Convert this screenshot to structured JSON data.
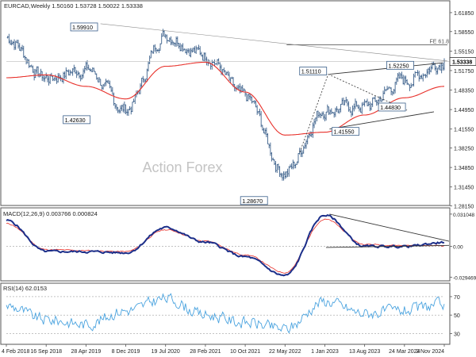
{
  "chart_data": [
    {
      "type": "line",
      "panel": "price",
      "header": "EURCAD,Weekly  1.50160 1.53728 1.50022 1.53338",
      "ylim": [
        1.285,
        1.635
      ],
      "y_ticks": [
        "1.61850",
        "1.58550",
        "1.55150",
        "1.51750",
        "1.48350",
        "1.44950",
        "1.41550",
        "1.38250",
        "1.34850",
        "1.31450",
        "1.28150"
      ],
      "last_price": "1.53338",
      "x_ticks": [
        "4 Feb 2018",
        "16 Sep 2018",
        "28 Apr 2019",
        "8 Dec 2019",
        "19 Jul 2020",
        "28 Feb 2021",
        "10 Oct 2021",
        "22 May 2022",
        "1 Jan 2023",
        "13 Aug 2023",
        "24 Mar 2024",
        "3 Nov 2024"
      ],
      "x": [
        "4 Feb 2018",
        "16 Sep 2018",
        "28 Apr 2019",
        "8 Dec 2019",
        "19 Jul 2020",
        "28 Feb 2021",
        "10 Oct 2021",
        "22 May 2022",
        "1 Jan 2023",
        "13 Aug 2023",
        "24 Mar 2024",
        "3 Nov 2024"
      ],
      "series": [
        {
          "values": [
            1.575,
            1.505,
            1.52,
            1.45,
            1.58,
            1.545,
            1.47,
            1.34,
            1.45,
            1.455,
            1.5,
            1.533
          ]
        },
        {
          "values": [
            1.505,
            1.51,
            1.49,
            1.468,
            1.525,
            1.532,
            1.48,
            1.405,
            1.41,
            1.44,
            1.47,
            1.49
          ]
        }
      ],
      "levels": [
        {
          "label": "1.59910",
          "value": 1.5991
        },
        {
          "label": "1.42630",
          "value": 1.4263
        },
        {
          "label": "1.28670",
          "value": 1.2867
        },
        {
          "label": "1.51110",
          "value": 1.5111
        },
        {
          "label": "1.41550",
          "value": 1.4155
        },
        {
          "label": "1.52250",
          "value": 1.5225
        },
        {
          "label": "1.44830",
          "value": 1.4483
        }
      ],
      "fibonacci_label": "FE 61.8",
      "fibonacci_value": 1.5625,
      "watermark": "Action Forex",
      "colors": {
        "price": "#3a5f8a",
        "ma": "#e8302a",
        "trend": "#333333",
        "fib": "#444444"
      }
    },
    {
      "type": "line",
      "panel": "macd",
      "header": "MACD(12,26,9) 0.003766 0.000824",
      "ylim": [
        -0.0315,
        0.034
      ],
      "y_ticks": [
        "0.031048",
        "0.00",
        "-0.029469"
      ],
      "x": [
        "4 Feb 2018",
        "16 Sep 2018",
        "28 Apr 2019",
        "8 Dec 2019",
        "19 Jul 2020",
        "28 Feb 2021",
        "10 Oct 2021",
        "22 May 2022",
        "1 Jan 2023",
        "13 Aug 2023",
        "24 Mar 2024",
        "3 Nov 2024"
      ],
      "series": [
        {
          "values": [
            0.025,
            -0.005,
            -0.005,
            -0.006,
            0.018,
            0.004,
            -0.01,
            -0.028,
            0.03,
            0.0,
            0.0,
            0.003766
          ]
        },
        {
          "values": [
            0.022,
            -0.003,
            -0.004,
            -0.005,
            0.016,
            0.005,
            -0.008,
            -0.025,
            0.026,
            0.002,
            0.001,
            0.000824
          ]
        }
      ],
      "colors": {
        "macd": "#1c2f8a",
        "signal": "#e8302a",
        "zero": "#888888"
      }
    },
    {
      "type": "line",
      "panel": "rsi",
      "header": "RSI(14) 62.0153",
      "ylim": [
        20,
        82
      ],
      "y_ticks": [
        "70",
        "50",
        "30"
      ],
      "x": [
        "4 Feb 2018",
        "16 Sep 2018",
        "28 Apr 2019",
        "8 Dec 2019",
        "19 Jul 2020",
        "28 Feb 2021",
        "10 Oct 2021",
        "22 May 2022",
        "1 Jan 2023",
        "13 Aug 2023",
        "24 Mar 2024",
        "3 Nov 2024"
      ],
      "series": [
        {
          "values": [
            60,
            45,
            40,
            55,
            68,
            50,
            42,
            35,
            65,
            52,
            55,
            62.0153
          ]
        }
      ],
      "colors": {
        "rsi": "#4aa3df",
        "band": "#888888"
      }
    }
  ]
}
